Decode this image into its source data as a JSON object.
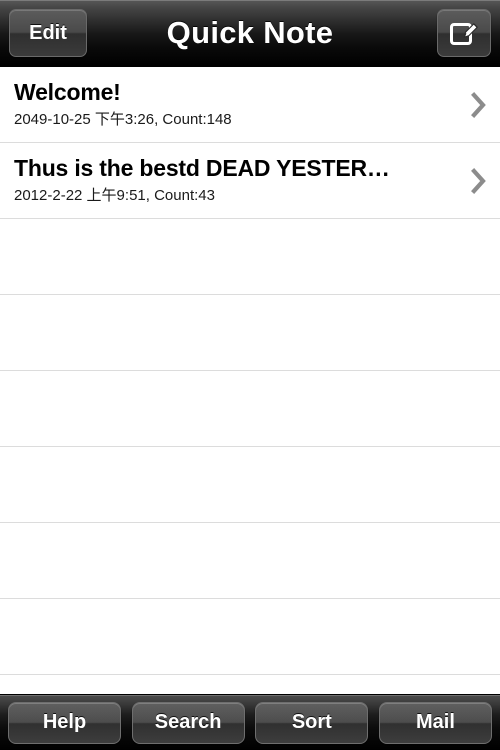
{
  "navbar": {
    "title": "Quick Note",
    "edit_label": "Edit",
    "compose_icon": "compose-icon"
  },
  "list": {
    "rows": [
      {
        "title": "Welcome!",
        "subtitle": "2049-10-25 下午3:26, Count:148",
        "accessory": "chevron-right-icon"
      },
      {
        "title": "Thus is the  bestd DEAD YESTER…",
        "subtitle": "2012-2-22 上午9:51, Count:43",
        "accessory": "chevron-right-icon"
      }
    ],
    "empty_row_count": 7
  },
  "toolbar": {
    "buttons": [
      {
        "label": "Help"
      },
      {
        "label": "Search"
      },
      {
        "label": "Sort"
      },
      {
        "label": "Mail"
      }
    ]
  },
  "colors": {
    "chrome_top": "#585858",
    "chrome_bottom": "#000000",
    "separator": "#dcdcdc",
    "chevron": "#8c8c8c",
    "list_background": "#ffffff",
    "title_text": "#000000",
    "subtitle_text": "#1a1a1a",
    "button_text": "#ffffff"
  }
}
